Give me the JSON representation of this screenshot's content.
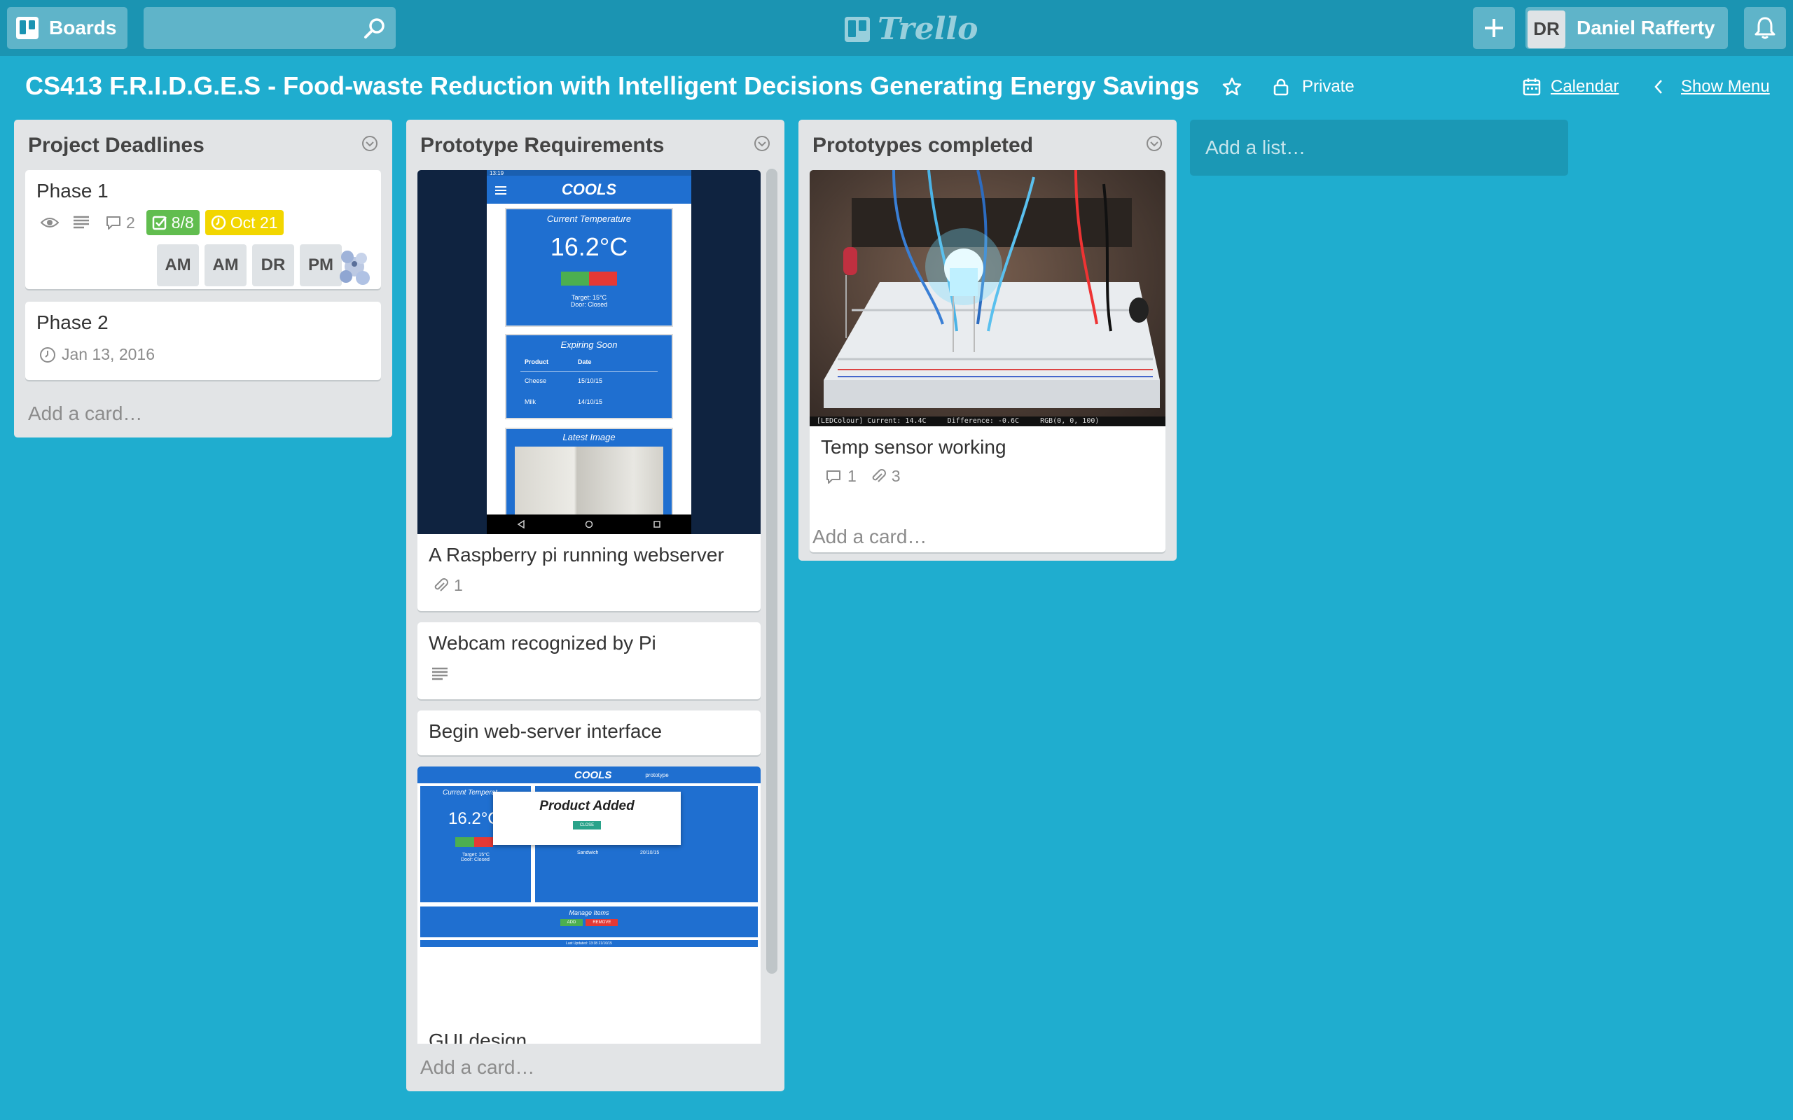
{
  "header": {
    "boards_label": "Boards",
    "search_value": "",
    "logo_text": "Trello",
    "user_initials": "DR",
    "user_name": "Daniel Rafferty"
  },
  "board": {
    "title": "CS413 F.R.I.D.G.E.S - Food-waste Reduction with Intelligent Decisions Generating Energy Savings",
    "starred": false,
    "visibility": "Private",
    "calendar_label": "Calendar",
    "show_menu_label": "Show Menu"
  },
  "lists": [
    {
      "name": "Project Deadlines",
      "add_card": "Add a card…",
      "cards": [
        {
          "title": "Phase 1",
          "comments": "2",
          "checklist": "8/8",
          "due": "Oct 21",
          "members": [
            "AM",
            "AM",
            "DR",
            "PM"
          ]
        },
        {
          "title": "Phase 2",
          "due": "Jan 13, 2016"
        }
      ]
    },
    {
      "name": "Prototype Requirements",
      "add_card": "Add a card…",
      "cards": [
        {
          "title": "A Raspberry pi running webserver",
          "attachments": "1",
          "cover": {
            "app_name": "COOLS",
            "status_time": "13:19",
            "section1": "Current Temperature",
            "temperature": "16.2°C",
            "target": "Target: 15°C",
            "door": "Door: Closed",
            "section2": "Expiring Soon",
            "col_product": "Product",
            "col_date": "Date",
            "row1_product": "Cheese",
            "row1_date": "15/10/15",
            "row2_product": "Milk",
            "row2_date": "14/10/15",
            "section3": "Latest Image"
          }
        },
        {
          "title": "Webcam recognized by Pi"
        },
        {
          "title": "Begin web-server interface"
        },
        {
          "title": "GUI design",
          "cover": {
            "app_name": "COOLS",
            "nav_item": "prototype",
            "section1": "Current Temperat",
            "temperature": "16.2°C",
            "target": "Target: 15°C",
            "door": "Door: Closed",
            "dialog_title": "Product Added",
            "dialog_button": "CLOSE",
            "row_product": "Sandwich",
            "row_date": "20/10/15",
            "manage_title": "Manage Items",
            "add_btn": "ADD",
            "remove_btn": "REMOVE",
            "last_updated": "Last Updated: 13:38 21/10/15"
          }
        }
      ]
    },
    {
      "name": "Prototypes completed",
      "add_card": "Add a card…",
      "cards": [
        {
          "title": "Temp sensor working",
          "comments": "1",
          "attachments": "3",
          "cover": {
            "overlay_text": "[LEDColour] Current: 14.4C     Difference: -0.6C     RGB(0, 0, 100)"
          }
        }
      ]
    }
  ],
  "add_list": "Add a list…",
  "colors": {
    "background": "#1fadcf",
    "header": "#1b94b2",
    "label_green": "#61bd4f",
    "label_yellow": "#f2d600"
  }
}
